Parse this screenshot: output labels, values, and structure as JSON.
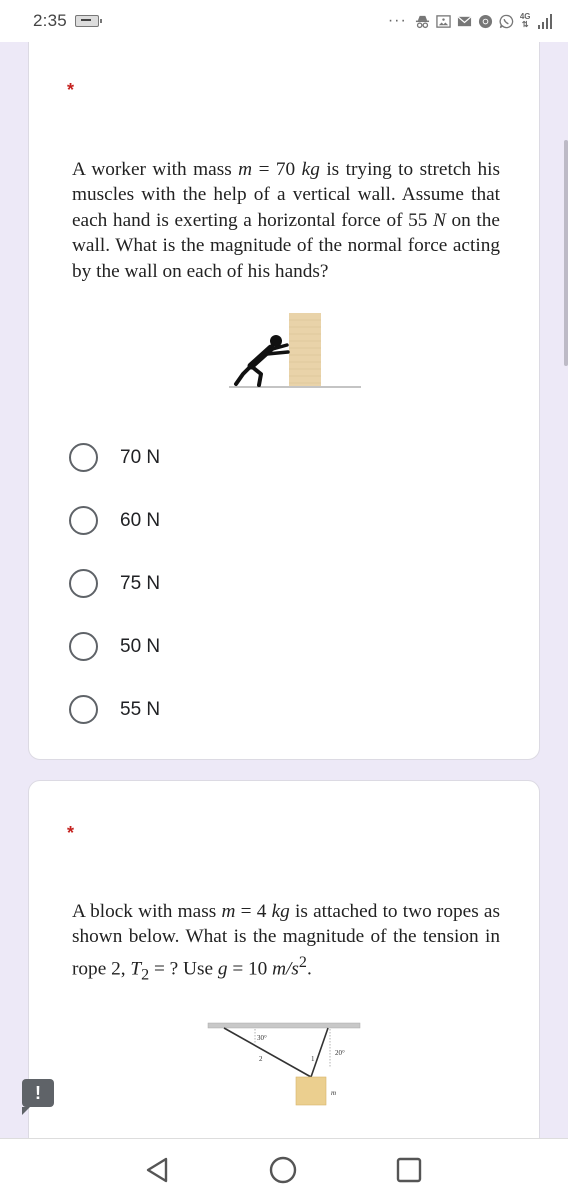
{
  "status_bar": {
    "time": "2:35",
    "overflow": "···",
    "network": "4G",
    "icons": [
      "battery-charging-icon",
      "incognito-icon",
      "gallery-icon",
      "mail-icon",
      "chrome-icon",
      "whatsapp-icon",
      "signal-icon"
    ]
  },
  "questions": [
    {
      "required_mark": "*",
      "text_parts": [
        "A worker with mass ",
        "m",
        " = 70 ",
        "kg",
        " is trying to stretch his muscles with the help of a vertical wall. Assume that each hand is exerting a horizontal force of 55 ",
        "N",
        " on the wall. What is the magnitude of the normal force acting by the wall on each of his hands?"
      ],
      "figure": "worker-pushing-wall-figure",
      "options": [
        {
          "label": "70 N",
          "selected": false
        },
        {
          "label": "60 N",
          "selected": false
        },
        {
          "label": "75 N",
          "selected": false
        },
        {
          "label": "50 N",
          "selected": false
        },
        {
          "label": "55 N",
          "selected": false
        }
      ]
    },
    {
      "required_mark": "*",
      "text_parts": [
        "A block with mass ",
        "m",
        " = 4 ",
        "kg",
        " is attached to two ropes as shown below. What is the magnitude of the tension in rope 2, ",
        "T",
        "2",
        " = ? Use ",
        "g",
        " = 10 ",
        "m/s",
        "2",
        "."
      ],
      "figure": {
        "name": "block-two-ropes-figure",
        "angle_rope2": "30°",
        "angle_rope1": "20°",
        "rope2_label": "2",
        "rope1_label": "1",
        "mass_label": "m"
      }
    }
  ],
  "feedback_icon": "!",
  "nav": {
    "back": "back-icon",
    "home": "home-icon",
    "recents": "recents-icon"
  },
  "colors": {
    "background": "#ede9f7",
    "required": "#c5221f",
    "radio_border": "#5f6368",
    "wall": "#e9d3a9"
  }
}
